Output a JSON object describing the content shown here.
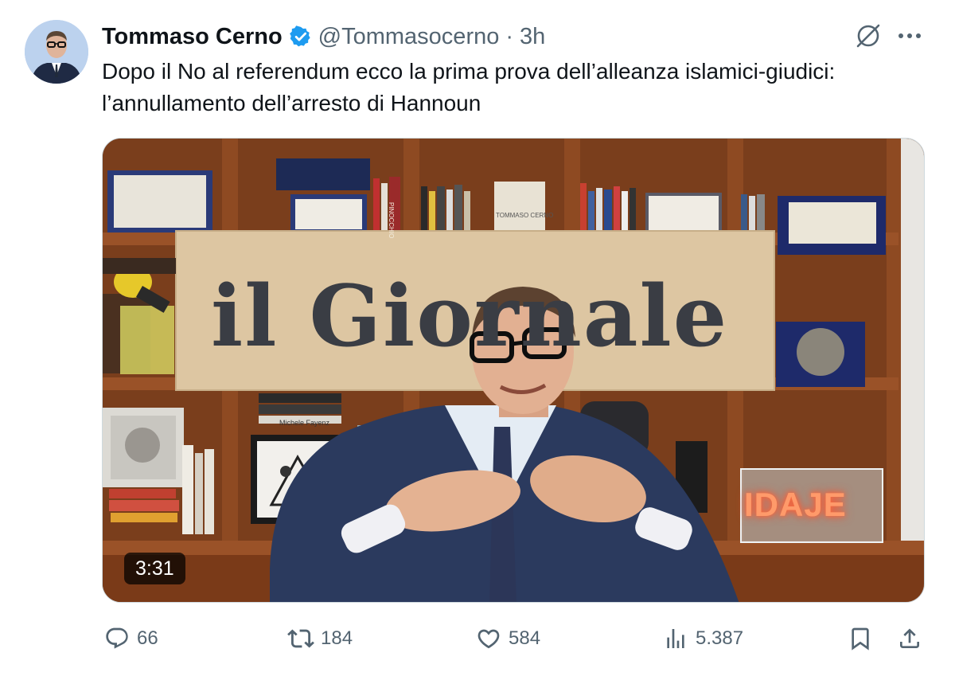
{
  "tweet": {
    "display_name": "Tommaso Cerno",
    "handle": "@Tommasocerno",
    "separator": "·",
    "time": "3h",
    "text": "Dopo il No al referendum ecco la prima prova dell’alleanza islamici-giudici: l’annullamento dell’arresto di Hannoun"
  },
  "media": {
    "sign_text": "il Giornale",
    "neon_text": "IDAJE",
    "book_label_1": "Michele Fayenz",
    "book_label_2": "PINOCCHIO",
    "book_label_3": "TOMMASO CERNO",
    "duration": "3:31"
  },
  "actions": {
    "replies": "66",
    "reposts": "184",
    "likes": "584",
    "views": "5.387"
  },
  "colors": {
    "text_primary": "#0f1419",
    "text_secondary": "#536471",
    "verified_blue": "#1d9bf0"
  },
  "icons": {
    "verified": "verified-badge-icon",
    "grok": "grok-icon",
    "more": "more-dots-icon",
    "reply": "reply-icon",
    "repost": "repost-icon",
    "like": "like-icon",
    "views": "views-icon",
    "bookmark": "bookmark-icon",
    "share": "share-icon"
  }
}
